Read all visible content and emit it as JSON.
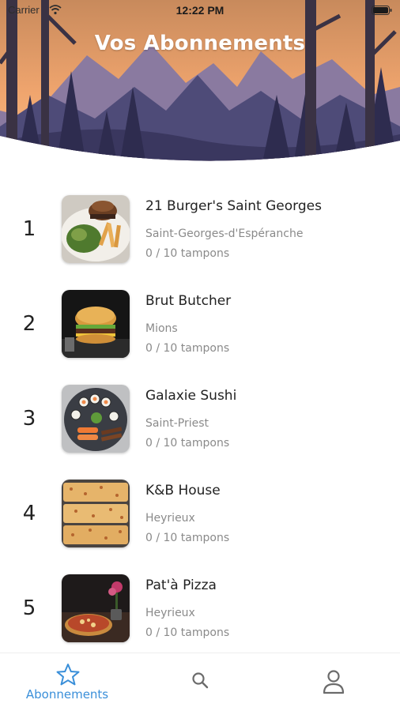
{
  "status_bar": {
    "carrier": "Carrier",
    "time": "12:22 PM",
    "icons": [
      "wifi-icon",
      "battery-icon"
    ]
  },
  "header": {
    "title": "Vos Abonnements"
  },
  "subscriptions": [
    {
      "rank": "1",
      "name": "21 Burger's Saint Georges",
      "city": "Saint-Georges-d'Espéranche",
      "stamps": "0 / 10 tampons"
    },
    {
      "rank": "2",
      "name": "Brut Butcher",
      "city": "Mions",
      "stamps": "0 / 10 tampons"
    },
    {
      "rank": "3",
      "name": "Galaxie Sushi",
      "city": "Saint-Priest",
      "stamps": "0 / 10 tampons"
    },
    {
      "rank": "4",
      "name": "K&B House",
      "city": "Heyrieux",
      "stamps": "0 / 10 tampons"
    },
    {
      "rank": "5",
      "name": "Pat'à Pizza",
      "city": "Heyrieux",
      "stamps": "0 / 10 tampons"
    }
  ],
  "tab_bar": {
    "tabs": [
      {
        "label": "Abonnements",
        "icon": "star-icon",
        "active": true
      },
      {
        "label": "",
        "icon": "search-icon",
        "active": false
      },
      {
        "label": "",
        "icon": "user-icon",
        "active": false
      }
    ],
    "active_color": "#3a8fd9",
    "inactive_color": "#6b6b6b"
  },
  "colors": {
    "title_text": "#ffffff",
    "secondary_text": "#8a8a8a",
    "sky_top": "#d9a06a",
    "sky_bottom": "#f6b77a"
  }
}
